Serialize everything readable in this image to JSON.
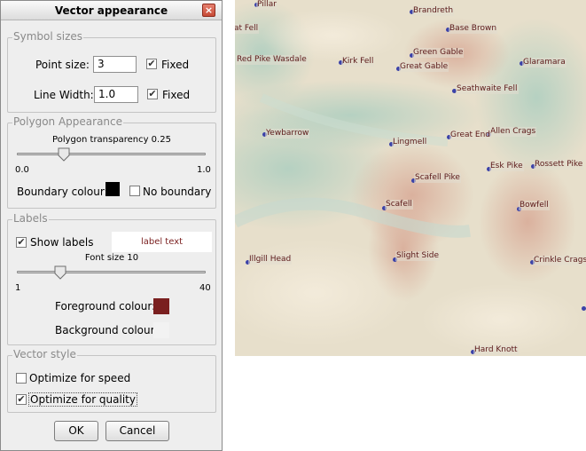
{
  "dialog": {
    "title": "Vector appearance",
    "close_glyph": "×",
    "symbol_sizes": {
      "legend": "Symbol sizes",
      "point_size_label": "Point size:",
      "point_size_value": "3",
      "point_fixed_label": "Fixed",
      "point_fixed_checked": "✔",
      "line_width_label": "Line Width:",
      "line_width_value": "1.0",
      "line_fixed_label": "Fixed",
      "line_fixed_checked": "✔"
    },
    "polygon": {
      "legend": "Polygon Appearance",
      "transparency_label": "Polygon transparency 0.25",
      "transparency_value": 0.25,
      "slider_min": "0.0",
      "slider_max": "1.0",
      "boundary_label": "Boundary colour:",
      "boundary_color": "#000000",
      "no_boundary_label": "No boundary",
      "no_boundary_checked": ""
    },
    "labels": {
      "legend": "Labels",
      "show_labels_label": "Show labels",
      "show_labels_checked": "✔",
      "preview_text": "label text",
      "font_size_label": "Font size 10",
      "font_size_value": 10,
      "slider_min": "1",
      "slider_max": "40",
      "foreground_label": "Foreground colour:",
      "foreground_color": "#7a1f1f",
      "background_label": "Background colour:",
      "background_color": "#f2f2f2"
    },
    "vector_style": {
      "legend": "Vector style",
      "speed_label": "Optimize for speed",
      "speed_checked": "",
      "quality_label": "Optimize for quality",
      "quality_checked": "✔"
    },
    "ok_label": "OK",
    "cancel_label": "Cancel"
  },
  "map": {
    "places": [
      "Pillar",
      "Brandreth",
      "at Fell",
      "Base Brown",
      "Green Gable",
      "Red Pike Wasdale",
      "Kirk Fell",
      "Great Gable",
      "Glaramara",
      "Seathwaite Fell",
      "Yewbarrow",
      "Allen Crags",
      "Great End",
      "Lingmell",
      "Esk Pike",
      "Rossett Pike",
      "Scafell Pike",
      "Scafell",
      "Bowfell",
      "Illgill Head",
      "Slight Side",
      "Crinkle Crags",
      "Hard Knott"
    ]
  }
}
